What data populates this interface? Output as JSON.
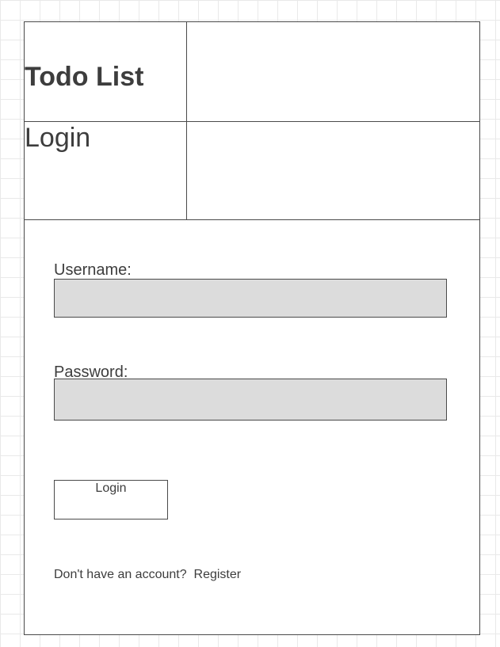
{
  "header": {
    "app_title": "Todo List",
    "page_heading": "Login"
  },
  "form": {
    "username": {
      "label": "Username:",
      "value": "",
      "placeholder": ""
    },
    "password": {
      "label": "Password:",
      "value": "",
      "placeholder": ""
    },
    "login_button_label": "Login"
  },
  "footer": {
    "prompt": "Don't have an account?",
    "register_link": "Register"
  },
  "colors": {
    "border": "#4a4a4a",
    "input_fill": "#dcdcdc",
    "text": "#3d3d3d",
    "grid": "#e9e9e9"
  }
}
